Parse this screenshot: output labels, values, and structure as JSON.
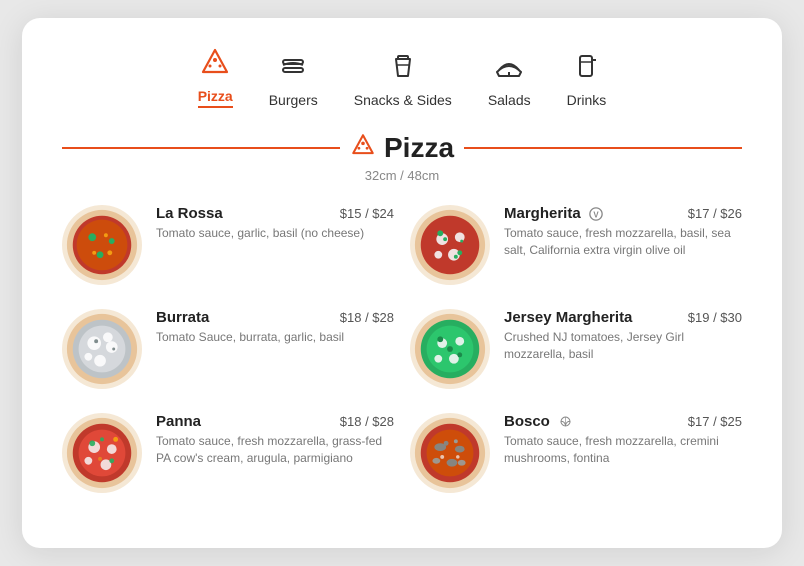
{
  "nav": {
    "items": [
      {
        "id": "pizza",
        "label": "Pizza",
        "icon": "🍕",
        "active": true
      },
      {
        "id": "burgers",
        "label": "Burgers",
        "icon": "🍔",
        "active": false
      },
      {
        "id": "snacks",
        "label": "Snacks & Sides",
        "icon": "🍟",
        "active": false
      },
      {
        "id": "salads",
        "label": "Salads",
        "icon": "🥗",
        "active": false
      },
      {
        "id": "drinks",
        "label": "Drinks",
        "icon": "🥤",
        "active": false
      }
    ]
  },
  "section": {
    "title": "Pizza",
    "subtitle": "32cm / 48cm",
    "icon": "🍕"
  },
  "menu_items": [
    {
      "id": "la-rossa",
      "name": "La Rossa",
      "price": "$15 / $24",
      "desc": "Tomato sauce, garlic, basil (no cheese)",
      "badge": "",
      "color1": "#c0392b",
      "color2": "#e67e22"
    },
    {
      "id": "margherita",
      "name": "Margherita",
      "price": "$17 / $26",
      "desc": "Tomato sauce, fresh mozzarella, basil, sea salt, California extra virgin olive oil",
      "badge": "V",
      "color1": "#c0392b",
      "color2": "#27ae60"
    },
    {
      "id": "burrata",
      "name": "Burrata",
      "price": "$18 / $28",
      "desc": "Tomato Sauce, burrata, garlic, basil",
      "badge": "",
      "color1": "#7f8c8d",
      "color2": "#bdc3c7"
    },
    {
      "id": "jersey-margherita",
      "name": "Jersey Margherita",
      "price": "$19 / $30",
      "desc": "Crushed NJ tomatoes, Jersey Girl mozzarella, basil",
      "badge": "",
      "color1": "#27ae60",
      "color2": "#2ecc71"
    },
    {
      "id": "panna",
      "name": "Panna",
      "price": "$18 / $28",
      "desc": "Tomato sauce, fresh mozzarella, grass-fed PA cow's cream, arugula, parmigiano",
      "badge": "",
      "color1": "#e74c3c",
      "color2": "#f39c12"
    },
    {
      "id": "bosco",
      "name": "Bosco",
      "price": "$17 / $25",
      "desc": "Tomato sauce, fresh mozzarella, cremini mushrooms, fontina",
      "badge": "leaf",
      "color1": "#c0392b",
      "color2": "#d35400"
    }
  ]
}
